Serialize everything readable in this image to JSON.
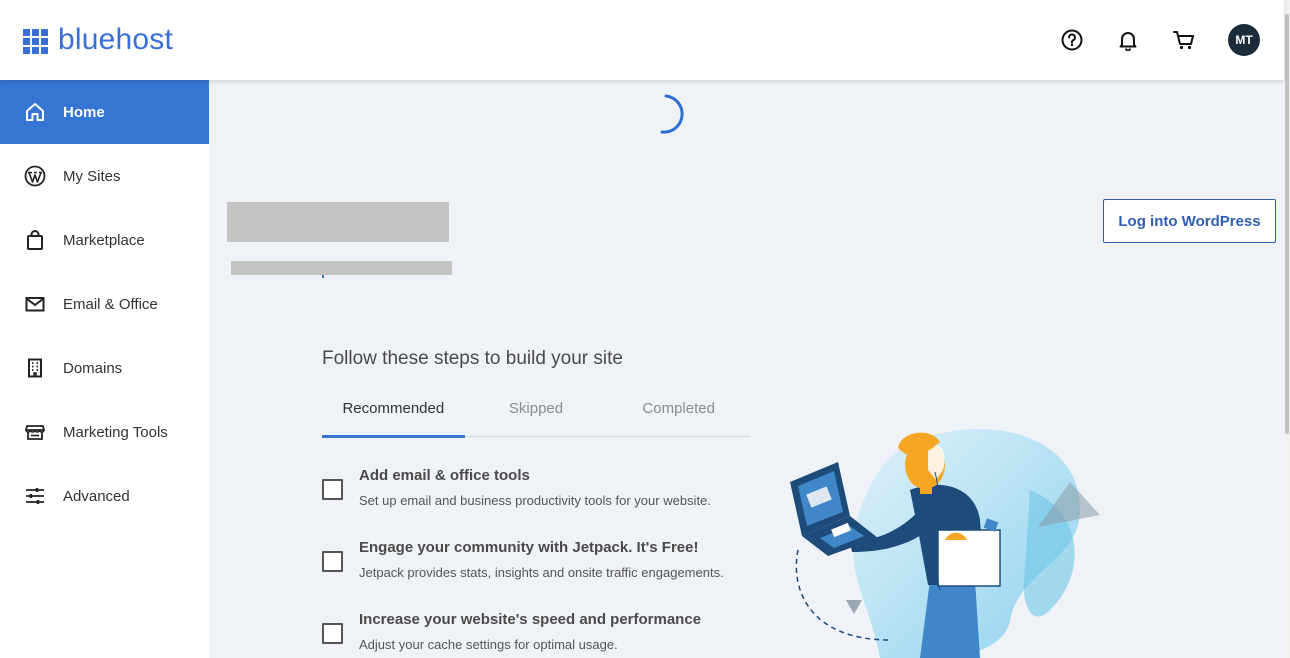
{
  "brand": {
    "name": "bluehost",
    "color": "#3a6fd8"
  },
  "header": {
    "icons": [
      "help-icon",
      "bell-icon",
      "cart-icon"
    ],
    "avatar_initials": "MT"
  },
  "sidebar": {
    "items": [
      {
        "label": "Home",
        "icon": "home-icon",
        "active": true
      },
      {
        "label": "My Sites",
        "icon": "wordpress-icon"
      },
      {
        "label": "Marketplace",
        "icon": "shopping-bag-icon"
      },
      {
        "label": "Email & Office",
        "icon": "envelope-icon"
      },
      {
        "label": "Domains",
        "icon": "building-icon"
      },
      {
        "label": "Marketing Tools",
        "icon": "storefront-icon"
      },
      {
        "label": "Advanced",
        "icon": "sliders-icon"
      }
    ]
  },
  "main": {
    "wp_button_label": "Log into WordPress",
    "steps_title": "Follow these steps to build your site",
    "tabs": [
      {
        "label": "Recommended",
        "active": true
      },
      {
        "label": "Skipped"
      },
      {
        "label": "Completed"
      }
    ],
    "steps": [
      {
        "title": "Add email & office tools",
        "desc": "Set up email and business productivity tools for your website."
      },
      {
        "title": "Engage your community with Jetpack. It's Free!",
        "desc": "Jetpack provides stats, insights and onsite traffic engagements."
      },
      {
        "title": "Increase your website's speed and performance",
        "desc": "Adjust your cache settings for optimal usage."
      }
    ]
  },
  "colors": {
    "accent": "#3575d3",
    "avatar_bg": "#1c2b3a",
    "page_bg": "#eff2f6"
  }
}
